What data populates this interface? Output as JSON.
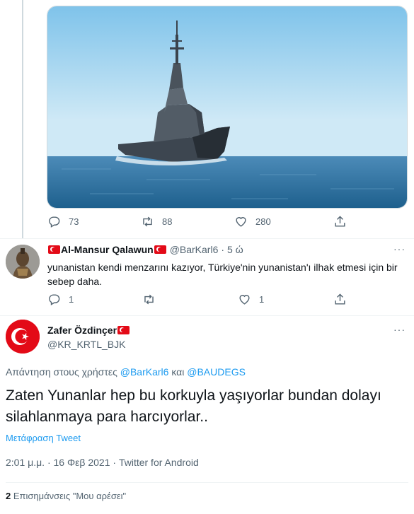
{
  "parent_tweet": {
    "counts": {
      "replies": "73",
      "retweets": "88",
      "likes": "280"
    }
  },
  "reply_tweet": {
    "display_name": "Al-Mansur Qalawun",
    "handle": "@BarKarl6",
    "separator": "·",
    "time": "5 ώ",
    "text": "yunanistan kendi menzarını kazıyor, Türkiye'nin yunanistan'ı ilhak etmesi için bir sebep daha.",
    "counts": {
      "replies": "1",
      "retweets": "",
      "likes": "1"
    }
  },
  "main_tweet": {
    "display_name": "Zafer Özdinçer",
    "handle": "@KR_KRTL_BJK",
    "replying_prefix": "Απάντηση στους χρήστες",
    "replying_to_1": "@BarKarl6",
    "replying_and": "και",
    "replying_to_2": "@BAUDEGS",
    "text": "Zaten Yunanlar hep bu korkuyla yaşıyorlar bundan dolayı silahlanmaya para harcıyorlar..",
    "translate_label": "Μετάφραση Tweet",
    "time": "2:01 μ.μ.",
    "date": "16 Φεβ 2021",
    "source": "Twitter for Android",
    "meta_separator": "·",
    "likes_count": "2",
    "likes_label": "Επισημάνσεις \"Μου αρέσει\""
  },
  "colors": {
    "accent": "#1d9bf0",
    "secondary_text": "#536471",
    "turkish_flag": "#e30a17"
  },
  "icons": [
    "reply-icon",
    "retweet-icon",
    "like-icon",
    "share-icon",
    "more-icon",
    "turkish-flag-icon"
  ]
}
